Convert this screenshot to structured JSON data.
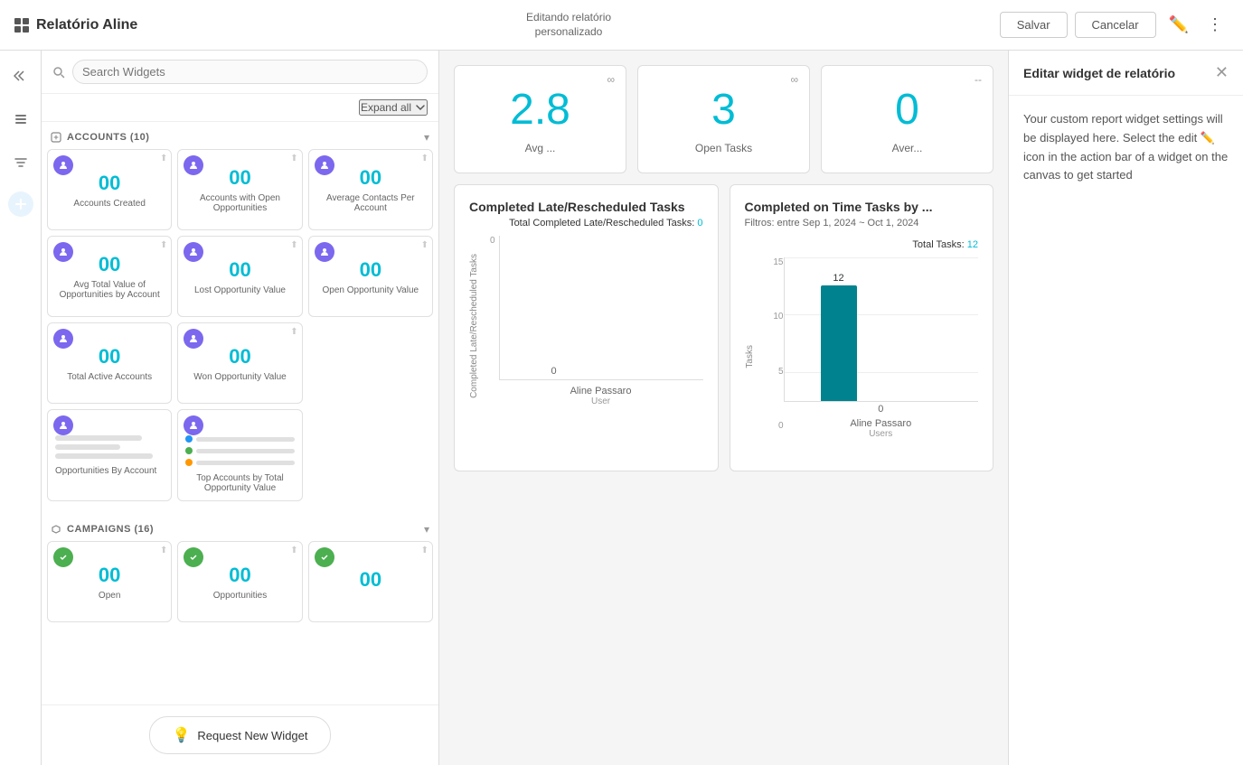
{
  "topbar": {
    "logo_text": "Relatório Aline",
    "editing_label_line1": "Editando relatório",
    "editing_label_line2": "personalizado",
    "save_btn": "Salvar",
    "cancel_btn": "Cancelar"
  },
  "sidebar": {
    "search_placeholder": "Search Widgets",
    "expand_all": "Expand all",
    "accounts_section": {
      "title": "ACCOUNTS (10)",
      "widgets": [
        {
          "label": "Accounts Created",
          "value": "00"
        },
        {
          "label": "Accounts with Open Opportunities",
          "value": "00"
        },
        {
          "label": "Average Contacts Per Account",
          "value": "00"
        },
        {
          "label": "Avg Total Value of Opportunities by Account",
          "value": "00"
        },
        {
          "label": "Lost Opportunity Value",
          "value": "00"
        },
        {
          "label": "Open Opportunity Value",
          "value": "00"
        },
        {
          "label": "Total Active Accounts",
          "value": "00"
        },
        {
          "label": "Won Opportunity Value",
          "value": "00"
        }
      ],
      "chart_widgets": [
        {
          "label": "Opportunities By Account"
        },
        {
          "label": "Top Accounts by Total Opportunity Value"
        }
      ]
    },
    "campaigns_section": {
      "title": "CAMPAIGNS (16)",
      "widgets": [
        {
          "label": "Open",
          "value": "00"
        },
        {
          "label": "Opportunities",
          "value": "00"
        },
        {
          "label": "",
          "value": "00"
        }
      ]
    },
    "request_widget_btn": "Request New Widget"
  },
  "canvas": {
    "metric_cards": [
      {
        "value": "2.8",
        "label": "Avg ...",
        "indicator": "∞"
      },
      {
        "value": "3",
        "label": "Open Tasks",
        "indicator": "∞"
      },
      {
        "value": "0",
        "label": "Aver...",
        "indicator": "--"
      }
    ],
    "chart1": {
      "title": "Completed Late/Rescheduled Tasks",
      "legend_label": "Total Completed Late/Rescheduled Tasks:",
      "legend_value": "0",
      "y_axis_label": "Completed Late/Rescheduled Tasks",
      "bars": [
        {
          "value": 0,
          "label": "Aline Passaro",
          "sublabel": "User",
          "display": "0"
        }
      ]
    },
    "chart2": {
      "title": "Completed on Time Tasks by ...",
      "filter": "Filtros: entre Sep 1, 2024 ~ Oct 1, 2024",
      "legend_label": "Total Tasks:",
      "legend_value": "12",
      "y_axis_label": "Tasks",
      "y_labels": [
        "15",
        "10",
        "5",
        "0"
      ],
      "bars": [
        {
          "value": 12,
          "label": "Aline Passaro",
          "sublabel": "Users",
          "display": "12",
          "zero_display": "0"
        }
      ]
    }
  },
  "right_panel": {
    "title": "Editar widget de relatório",
    "body_text": "Your custom report widget settings will be displayed here. Select the edit",
    "body_text2": "icon in the action bar of a widget on the canvas to get started"
  }
}
